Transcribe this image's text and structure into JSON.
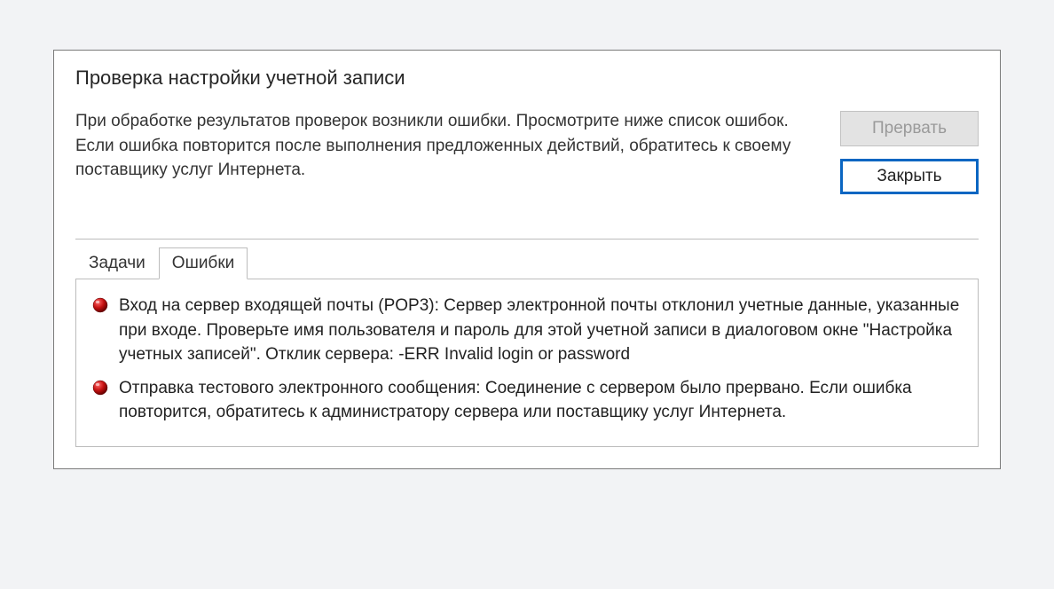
{
  "dialog": {
    "title": "Проверка настройки учетной записи",
    "message": "При обработке результатов проверок возникли ошибки. Просмотрите ниже список ошибок. Если ошибка повторится после выполнения предложенных действий, обратитесь к своему поставщику услуг Интернета.",
    "buttons": {
      "abort": "Прервать",
      "close": "Закрыть"
    },
    "tabs": {
      "tasks": "Задачи",
      "errors": "Ошибки"
    },
    "errors": [
      "Вход на сервер входящей почты (POP3): Сервер электронной почты отклонил учетные данные, указанные при входе. Проверьте имя пользователя и пароль для этой учетной записи в диалоговом окне \"Настройка учетных записей\".  Отклик сервера: -ERR Invalid login or password",
      "Отправка тестового электронного сообщения: Соединение с сервером было прервано. Если ошибка повторится, обратитесь к администратору сервера или поставщику услуг Интернета."
    ]
  }
}
